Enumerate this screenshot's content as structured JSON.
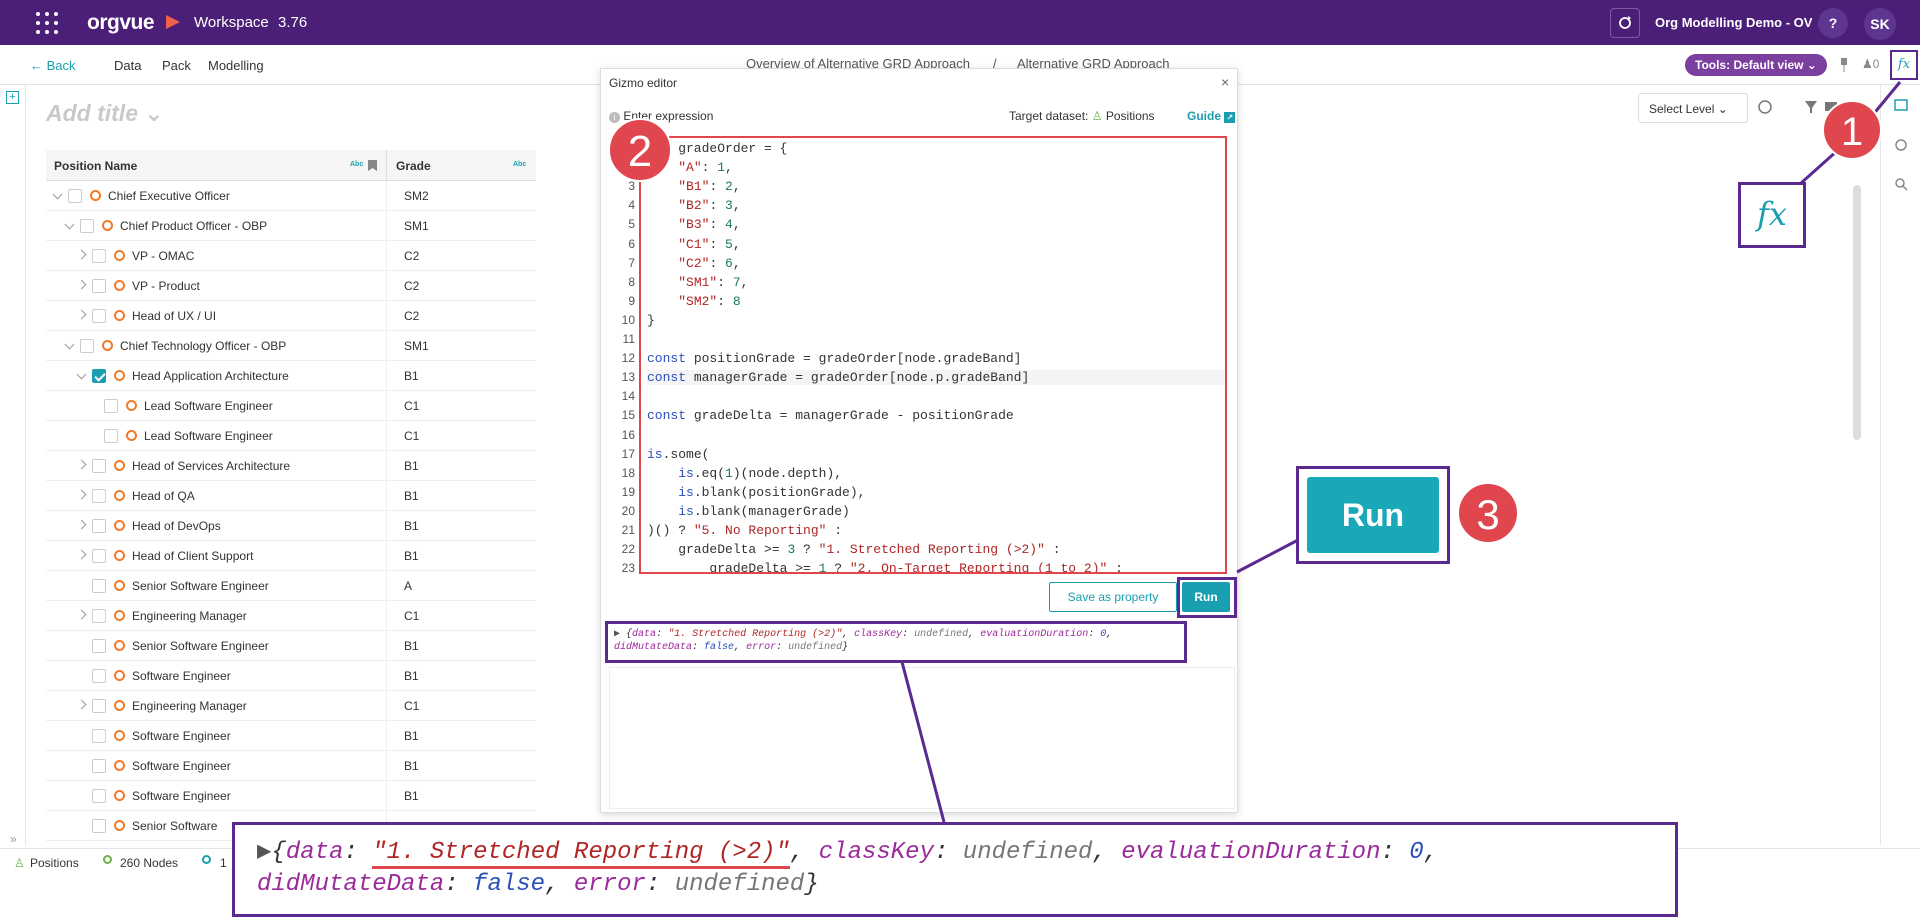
{
  "app": {
    "logo": "orgvue",
    "workspace": "Workspace",
    "version": "3.76",
    "project": "Org Modelling Demo - OV",
    "help": "?",
    "user_initials": "SK"
  },
  "subnav": {
    "back": "Back",
    "items": [
      "Data",
      "Pack",
      "Modelling"
    ],
    "breadcrumb": [
      "Overview of Alternative GRD Approach",
      "/",
      "Alternative GRD Approach"
    ],
    "tools": "Tools: Default view",
    "user_count": "0"
  },
  "canvas": {
    "add_title": "Add title",
    "select_level": "Select Level"
  },
  "table": {
    "columns": [
      "Position Name",
      "Grade"
    ],
    "col_tag": "Abc",
    "rows": [
      {
        "name": "Chief Executive Officer",
        "grade": "SM2",
        "depth": 0,
        "expand": "down",
        "checked": false
      },
      {
        "name": "Chief Product Officer - OBP",
        "grade": "SM1",
        "depth": 1,
        "expand": "down",
        "checked": false
      },
      {
        "name": "VP - OMAC",
        "grade": "C2",
        "depth": 2,
        "expand": "right",
        "checked": false
      },
      {
        "name": "VP - Product",
        "grade": "C2",
        "depth": 2,
        "expand": "right",
        "checked": false
      },
      {
        "name": "Head of UX / UI",
        "grade": "C2",
        "depth": 2,
        "expand": "right",
        "checked": false
      },
      {
        "name": "Chief Technology Officer - OBP",
        "grade": "SM1",
        "depth": 1,
        "expand": "down",
        "checked": false
      },
      {
        "name": "Head Application Architecture",
        "grade": "B1",
        "depth": 2,
        "expand": "down",
        "checked": true
      },
      {
        "name": "Lead Software Engineer",
        "grade": "C1",
        "depth": 3,
        "expand": "",
        "checked": false
      },
      {
        "name": "Lead Software Engineer",
        "grade": "C1",
        "depth": 3,
        "expand": "",
        "checked": false
      },
      {
        "name": "Head of Services Architecture",
        "grade": "B1",
        "depth": 2,
        "expand": "right",
        "checked": false
      },
      {
        "name": "Head of QA",
        "grade": "B1",
        "depth": 2,
        "expand": "right",
        "checked": false
      },
      {
        "name": "Head of DevOps",
        "grade": "B1",
        "depth": 2,
        "expand": "right",
        "checked": false
      },
      {
        "name": "Head of Client Support",
        "grade": "B1",
        "depth": 2,
        "expand": "right",
        "checked": false
      },
      {
        "name": "Senior Software Engineer",
        "grade": "A",
        "depth": 2,
        "expand": "",
        "checked": false
      },
      {
        "name": "Engineering Manager",
        "grade": "C1",
        "depth": 2,
        "expand": "right",
        "checked": false
      },
      {
        "name": "Senior Software Engineer",
        "grade": "B1",
        "depth": 2,
        "expand": "",
        "checked": false
      },
      {
        "name": "Software Engineer",
        "grade": "B1",
        "depth": 2,
        "expand": "",
        "checked": false
      },
      {
        "name": "Engineering Manager",
        "grade": "C1",
        "depth": 2,
        "expand": "right",
        "checked": false
      },
      {
        "name": "Software Engineer",
        "grade": "B1",
        "depth": 2,
        "expand": "",
        "checked": false
      },
      {
        "name": "Software Engineer",
        "grade": "B1",
        "depth": 2,
        "expand": "",
        "checked": false
      },
      {
        "name": "Software Engineer",
        "grade": "B1",
        "depth": 2,
        "expand": "",
        "checked": false
      },
      {
        "name": "Senior Software",
        "grade": "",
        "depth": 2,
        "expand": "",
        "checked": false
      }
    ]
  },
  "bottom": {
    "positions": "Positions",
    "nodes": "260 Nodes",
    "extra": "1"
  },
  "editor": {
    "title": "Gizmo editor",
    "close": "×",
    "expr_label": "Enter expression",
    "target_label": "Target dataset:",
    "target_value": "Positions",
    "guide": "Guide",
    "save_property": "Save as property",
    "run": "Run",
    "code_lines": [
      {
        "n": "",
        "t": "    gradeOrder = {"
      },
      {
        "n": "",
        "t": "    \"A\": 1,"
      },
      {
        "n": "3",
        "t": "    \"B1\": 2,"
      },
      {
        "n": "4",
        "t": "    \"B2\": 3,"
      },
      {
        "n": "5",
        "t": "    \"B3\": 4,"
      },
      {
        "n": "6",
        "t": "    \"C1\": 5,"
      },
      {
        "n": "7",
        "t": "    \"C2\": 6,"
      },
      {
        "n": "8",
        "t": "    \"SM1\": 7,"
      },
      {
        "n": "9",
        "t": "    \"SM2\": 8"
      },
      {
        "n": "10",
        "t": "}"
      },
      {
        "n": "11",
        "t": ""
      },
      {
        "n": "12",
        "t": "const positionGrade = gradeOrder[node.gradeBand]"
      },
      {
        "n": "13",
        "t": "const managerGrade = gradeOrder[node.p.gradeBand]"
      },
      {
        "n": "14",
        "t": ""
      },
      {
        "n": "15",
        "t": "const gradeDelta = managerGrade - positionGrade"
      },
      {
        "n": "16",
        "t": ""
      },
      {
        "n": "17",
        "t": "is.some("
      },
      {
        "n": "18",
        "t": "    is.eq(1)(node.depth),"
      },
      {
        "n": "19",
        "t": "    is.blank(positionGrade),"
      },
      {
        "n": "20",
        "t": "    is.blank(managerGrade)"
      },
      {
        "n": "21",
        "t": ")() ? \"5. No Reporting\" :"
      },
      {
        "n": "22",
        "t": "    gradeDelta >= 3 ? \"1. Stretched Reporting (>2)\" :"
      },
      {
        "n": "23",
        "t": "        gradeDelta >= 1 ? \"2. On-Target Reporting (1 to 2)\" :"
      }
    ],
    "result": {
      "k1": "data",
      "v1": "\"1. Stretched Reporting (>2)\"",
      "k2": "classKey",
      "v2": "undefined",
      "k3": "evaluationDuration",
      "v3": "0",
      "k4": "didMutateData",
      "v4": "false",
      "k5": "error",
      "v5": "undefined"
    }
  },
  "annotations": {
    "badge1": "1",
    "badge2": "2",
    "badge3": "3",
    "fx": "fx",
    "run": "Run"
  },
  "colors": {
    "brand": "#4b1f78",
    "accent": "#1a9fb0",
    "highlight": "#e0464e",
    "callout": "#5b2a90"
  }
}
